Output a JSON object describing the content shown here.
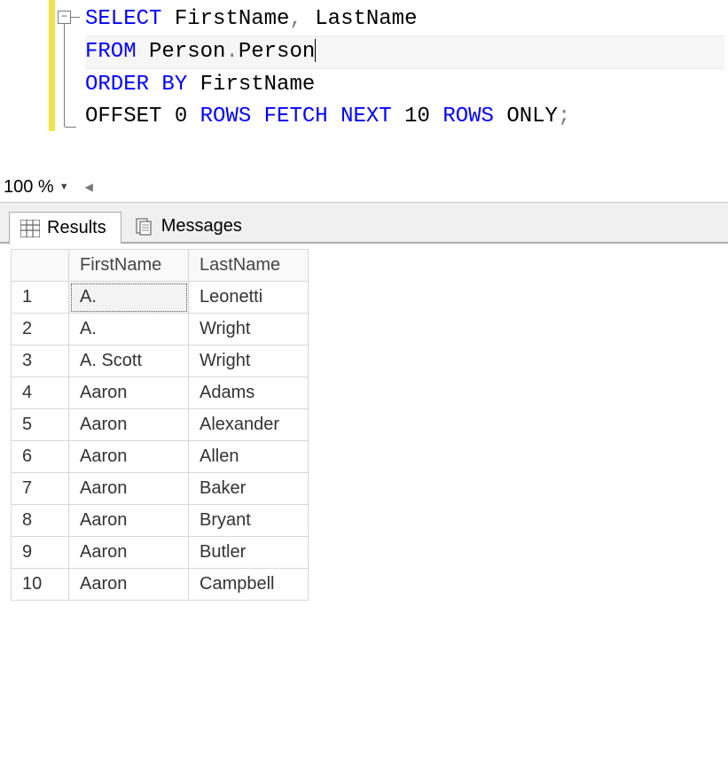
{
  "editor": {
    "fold_glyph": "−",
    "lines": [
      {
        "tokens": [
          {
            "t": "SELECT",
            "c": "kw"
          },
          {
            "t": " "
          },
          {
            "t": "FirstName",
            "c": "ident"
          },
          {
            "t": ",",
            "c": "op"
          },
          {
            "t": " "
          },
          {
            "t": "LastName",
            "c": "ident"
          }
        ]
      },
      {
        "tokens": [
          {
            "t": "FROM",
            "c": "kw"
          },
          {
            "t": " "
          },
          {
            "t": "Person",
            "c": "ident"
          },
          {
            "t": ".",
            "c": "op"
          },
          {
            "t": "Person",
            "c": "ident"
          }
        ],
        "highlight": true,
        "caret_after": true
      },
      {
        "tokens": [
          {
            "t": "ORDER",
            "c": "kw"
          },
          {
            "t": " "
          },
          {
            "t": "BY",
            "c": "kw"
          },
          {
            "t": " "
          },
          {
            "t": "FirstName",
            "c": "ident"
          }
        ]
      },
      {
        "tokens": [
          {
            "t": "OFFSET",
            "c": "ident"
          },
          {
            "t": " "
          },
          {
            "t": "0",
            "c": "num"
          },
          {
            "t": " "
          },
          {
            "t": "ROWS",
            "c": "kw"
          },
          {
            "t": " "
          },
          {
            "t": "FETCH",
            "c": "kw"
          },
          {
            "t": " "
          },
          {
            "t": "NEXT",
            "c": "kw"
          },
          {
            "t": " "
          },
          {
            "t": "10",
            "c": "num"
          },
          {
            "t": " "
          },
          {
            "t": "ROWS",
            "c": "kw"
          },
          {
            "t": " "
          },
          {
            "t": "ONLY",
            "c": "ident"
          },
          {
            "t": ";",
            "c": "op"
          }
        ]
      }
    ]
  },
  "zoom": {
    "value": "100 %"
  },
  "tabs": {
    "results_label": "Results",
    "messages_label": "Messages",
    "active": "results"
  },
  "results": {
    "columns": [
      "FirstName",
      "LastName"
    ],
    "rows": [
      [
        "A.",
        "Leonetti"
      ],
      [
        "A.",
        "Wright"
      ],
      [
        "A. Scott",
        "Wright"
      ],
      [
        "Aaron",
        "Adams"
      ],
      [
        "Aaron",
        "Alexander"
      ],
      [
        "Aaron",
        "Allen"
      ],
      [
        "Aaron",
        "Baker"
      ],
      [
        "Aaron",
        "Bryant"
      ],
      [
        "Aaron",
        "Butler"
      ],
      [
        "Aaron",
        "Campbell"
      ]
    ],
    "focused_cell": {
      "row": 0,
      "col": 0
    }
  }
}
